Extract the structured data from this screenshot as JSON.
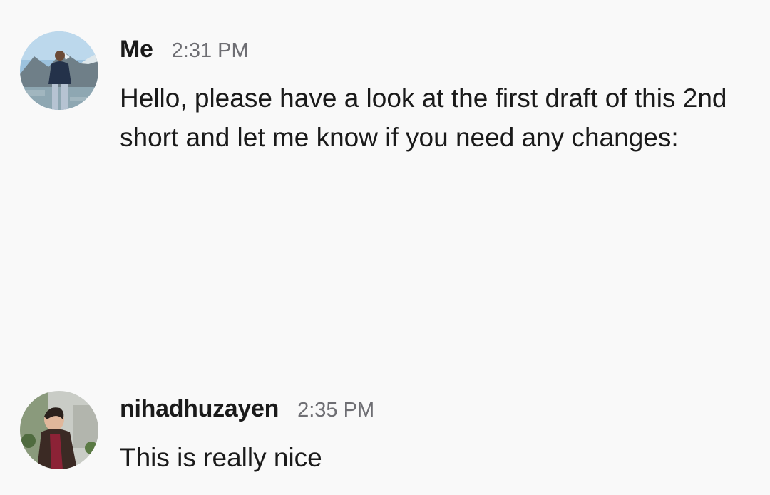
{
  "messages": [
    {
      "sender": "Me",
      "time": "2:31 PM",
      "text": "Hello, please have a look at the first draft of this 2nd short and let me know if you need any changes:"
    },
    {
      "sender": "nihadhuzayen",
      "time": "2:35 PM",
      "text": "This is really nice"
    }
  ]
}
